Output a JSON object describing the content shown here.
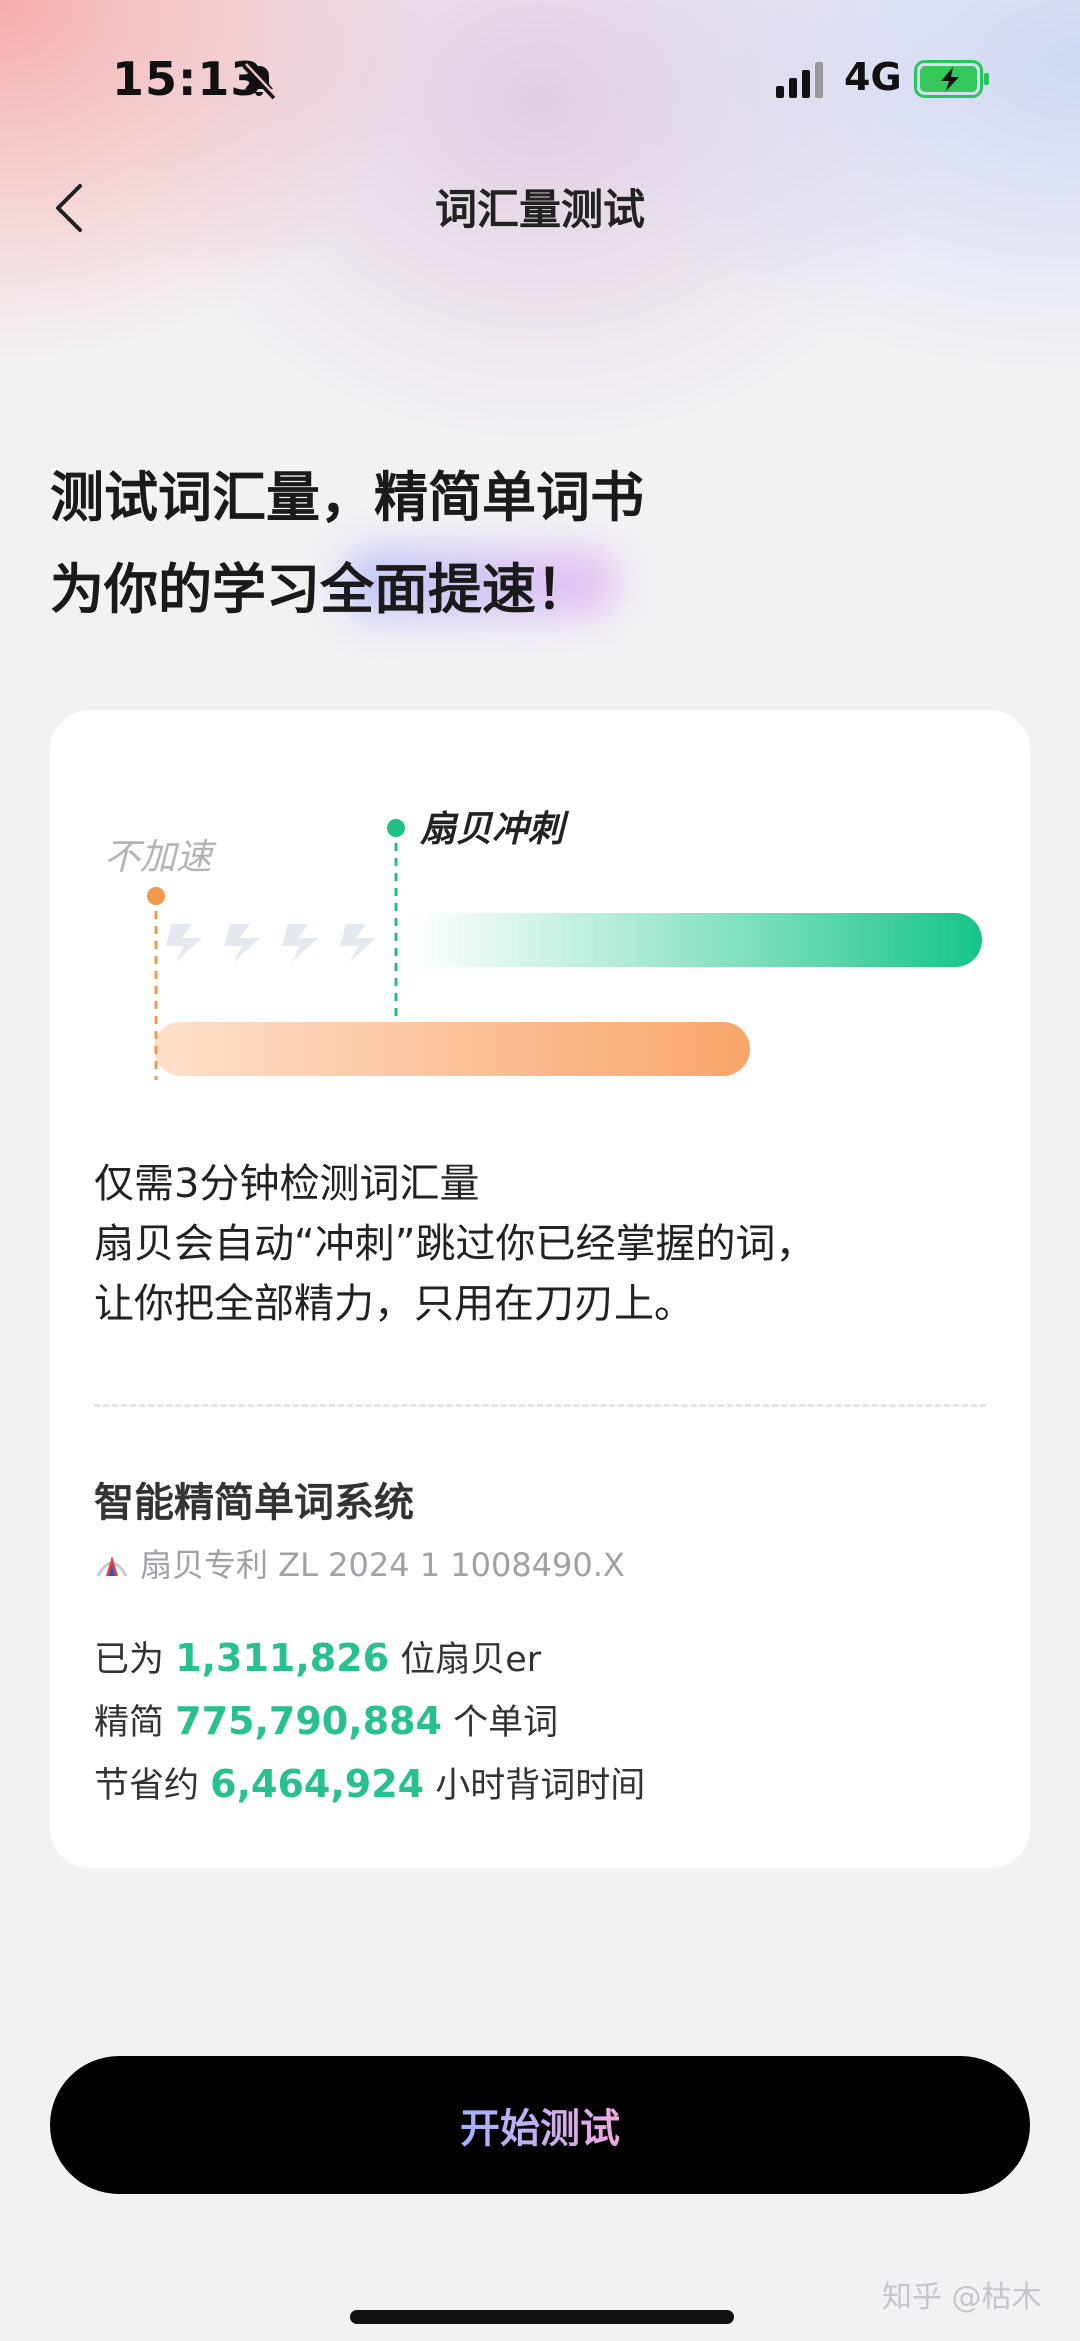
{
  "status_bar": {
    "time": "15:13",
    "network": "4G"
  },
  "nav": {
    "title": "词汇量测试"
  },
  "headline": {
    "line1": "测试词汇量，精简单词书",
    "line2": "为你的学习全面提速！"
  },
  "chart": {
    "label_normal": "不加速",
    "label_sprint": "扇贝冲刺"
  },
  "description": {
    "line1": "仅需3分钟检测词汇量",
    "line2": "扇贝会自动“冲刺”跳过你已经掌握的词，",
    "line3": "让你把全部精力，只用在刀刃上。"
  },
  "system": {
    "title": "智能精简单词系统",
    "patent": "扇贝专利 ZL 2024 1 1008490.X"
  },
  "stats": {
    "users_prefix": "已为",
    "users_value": "1,311,826",
    "users_suffix": "位扇贝er",
    "words_prefix": "精简",
    "words_value": "775,790,884",
    "words_suffix": "个单词",
    "hours_prefix": "节省约",
    "hours_value": "6,464,924",
    "hours_suffix": "小时背词时间"
  },
  "button": {
    "start_label": "开始测试"
  },
  "watermark": "知乎 @枯木",
  "colors": {
    "accent_green": "#28c08e",
    "accent_orange": "#f9a56a",
    "button_bg": "#000000"
  },
  "icons": [
    "mute-icon",
    "signal-icon",
    "battery-icon",
    "back-icon",
    "lightning-icon",
    "patent-logo-icon"
  ]
}
